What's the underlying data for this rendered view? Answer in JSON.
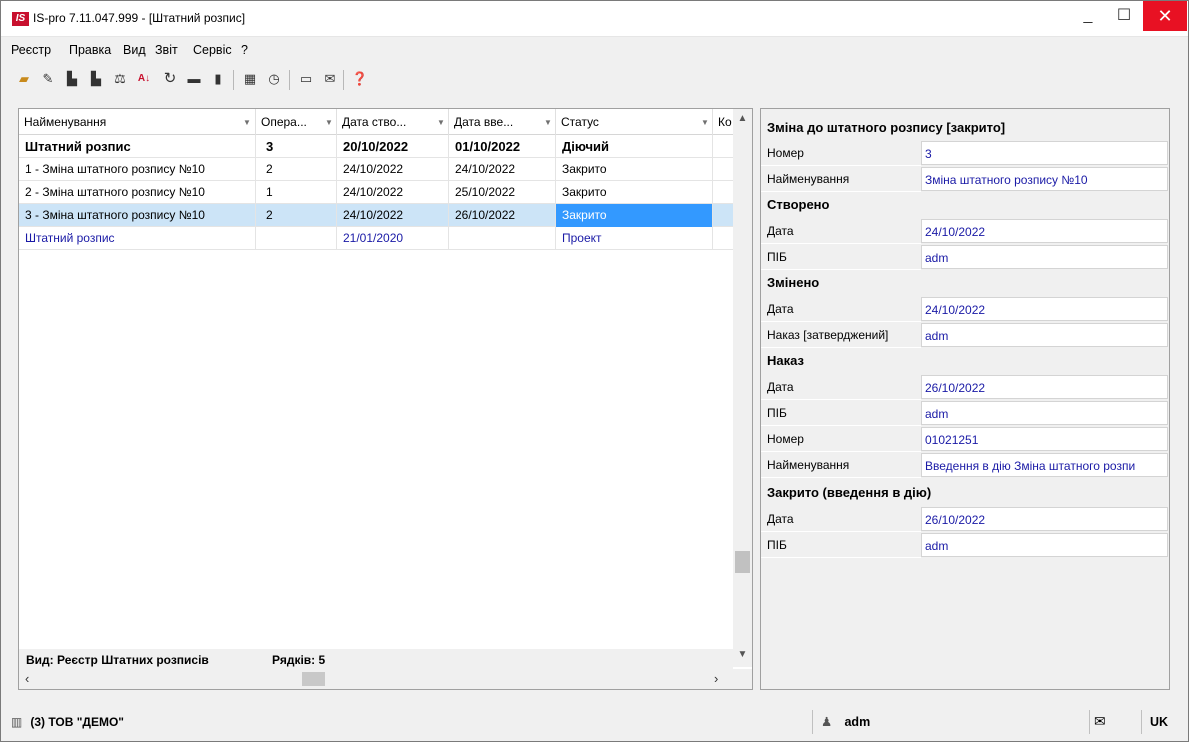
{
  "window": {
    "logo": "IS",
    "title": "IS-pro 7.11.047.999 - [Штатний розпис]",
    "minimize": "_",
    "maximize": "☐",
    "close": "✕"
  },
  "menu": [
    "Реєстр",
    "Правка",
    "Вид",
    "Звіт",
    "Сервіс",
    "?"
  ],
  "toolbar_icons": [
    "open-folder-icon",
    "new-doc-icon",
    "copy-icon",
    "paste-icon",
    "scale-icon",
    "sort-icon",
    "refresh-icon",
    "print-icon",
    "book-icon",
    "grid-icon",
    "calc-icon",
    "form-icon",
    "mail-icon",
    "help-icon"
  ],
  "grid": {
    "columns": [
      "Найменування",
      "Опера...",
      "Дата ство...",
      "Дата вве...",
      "Статус",
      "Ко"
    ],
    "rows": [
      {
        "name": "Штатний розпис",
        "op": "3",
        "created": "20/10/2022",
        "entered": "01/10/2022",
        "status": "Діючий"
      },
      {
        "name": "1 - Зміна штатного розпису №10",
        "op": "2",
        "created": "24/10/2022",
        "entered": "24/10/2022",
        "status": "Закрито"
      },
      {
        "name": "2 - Зміна штатного розпису №10",
        "op": "1",
        "created": "24/10/2022",
        "entered": "25/10/2022",
        "status": "Закрито"
      },
      {
        "name": "3 - Зміна штатного розпису №10",
        "op": "2",
        "created": "24/10/2022",
        "entered": "26/10/2022",
        "status": "Закрито"
      },
      {
        "name": "Штатний розпис",
        "op": "",
        "created": "21/01/2020",
        "entered": "",
        "status": "Проект"
      }
    ],
    "footer_view": "Вид: Реєстр Штатних розписів",
    "footer_rows": "Рядків: 5"
  },
  "detail": {
    "title": "Зміна до штатного розпису [закрито]",
    "number_label": "Номер",
    "number_value": "3",
    "name_label": "Найменування",
    "name_value": "Зміна штатного розпису №10",
    "created": {
      "section": "Створено",
      "date_label": "Дата",
      "date_value": "24/10/2022",
      "pib_label": "ПІБ",
      "pib_value": "adm"
    },
    "changed": {
      "section": "Змінено",
      "date_label": "Дата",
      "date_value": "24/10/2022",
      "order_label": "Наказ [затверджений]",
      "order_value": "adm"
    },
    "order": {
      "section": "Наказ",
      "date_label": "Дата",
      "date_value": "26/10/2022",
      "pib_label": "ПІБ",
      "pib_value": "adm",
      "number_label": "Номер",
      "number_value": "01021251",
      "name_label": "Найменування",
      "name_value": "Введення в дію Зміна штатного розпи"
    },
    "closed": {
      "section": "Закрито (введення в дію)",
      "date_label": "Дата",
      "date_value": "26/10/2022",
      "pib_label": "ПІБ",
      "pib_value": "adm"
    }
  },
  "status_bar": {
    "org": "(3) ТОВ \"ДЕМО\"",
    "user": "adm",
    "lang": "UK"
  },
  "colors": {
    "link_blue": "#1a1aa6",
    "selection": "#cce4f7",
    "focus_cell": "#3399ff",
    "close_red": "#e81123"
  }
}
